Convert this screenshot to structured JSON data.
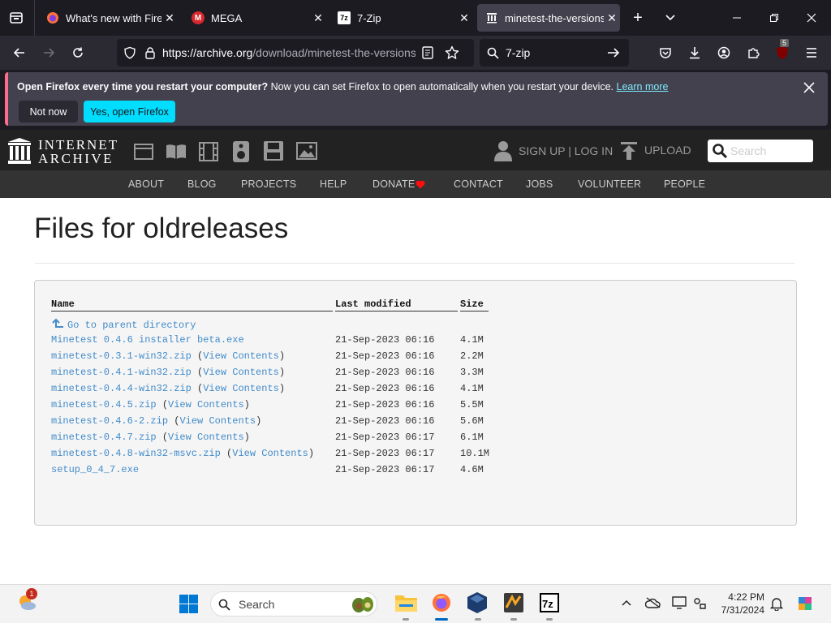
{
  "browser": {
    "tabs": [
      {
        "title": "What's new with Firefox",
        "icon": "firefox-icon",
        "active": false
      },
      {
        "title": "MEGA",
        "icon": "mega-icon",
        "active": false
      },
      {
        "title": "7-Zip",
        "icon": "7zip-icon",
        "active": false
      },
      {
        "title": "minetest-the-versions",
        "icon": "archive-icon",
        "active": true
      }
    ],
    "url_host": "https://archive.org",
    "url_path": "/download/minetest-the-versions",
    "search_query": "7-zip",
    "badge_count": "5"
  },
  "notification": {
    "bold": "Open Firefox every time you restart your computer?",
    "text": " Now you can set Firefox to open automatically when you restart your device. ",
    "link": "Learn more",
    "not_now": "Not now",
    "yes": "Yes, open Firefox"
  },
  "ia": {
    "logo_line1": "INTERNET",
    "logo_line2": "ARCHIVE",
    "signin": "SIGN UP | LOG IN",
    "upload": "UPLOAD",
    "search_placeholder": "Search",
    "menu": [
      "ABOUT",
      "BLOG",
      "PROJECTS",
      "HELP",
      "DONATE",
      "CONTACT",
      "JOBS",
      "VOLUNTEER",
      "PEOPLE"
    ]
  },
  "page": {
    "title": "Files for oldreleases",
    "headers": {
      "name": "Name",
      "modified": "Last modified",
      "size": "Size"
    },
    "parent": "Go to parent directory",
    "view_contents": "View Contents",
    "files": [
      {
        "name": "Minetest 0.4.6 installer beta.exe",
        "modified": "21-Sep-2023 06:16",
        "size": "4.1M",
        "view": false
      },
      {
        "name": "minetest-0.3.1-win32.zip",
        "modified": "21-Sep-2023 06:16",
        "size": "2.2M",
        "view": true
      },
      {
        "name": "minetest-0.4.1-win32.zip",
        "modified": "21-Sep-2023 06:16",
        "size": "3.3M",
        "view": true
      },
      {
        "name": "minetest-0.4.4-win32.zip",
        "modified": "21-Sep-2023 06:16",
        "size": "4.1M",
        "view": true
      },
      {
        "name": "minetest-0.4.5.zip",
        "modified": "21-Sep-2023 06:16",
        "size": "5.5M",
        "view": true
      },
      {
        "name": "minetest-0.4.6-2.zip",
        "modified": "21-Sep-2023 06:16",
        "size": "5.6M",
        "view": true
      },
      {
        "name": "minetest-0.4.7.zip",
        "modified": "21-Sep-2023 06:17",
        "size": "6.1M",
        "view": true
      },
      {
        "name": "minetest-0.4.8-win32-msvc.zip",
        "modified": "21-Sep-2023 06:17",
        "size": "10.1M",
        "view": true
      },
      {
        "name": "setup_0_4_7.exe",
        "modified": "21-Sep-2023 06:17",
        "size": "4.6M",
        "view": false
      }
    ]
  },
  "taskbar": {
    "search_placeholder": "Search",
    "time": "4:22 PM",
    "date": "7/31/2024",
    "weather_badge": "1"
  },
  "colors": {
    "link": "#428bca",
    "accent": "#00ddff",
    "ia_dark": "#222222"
  }
}
